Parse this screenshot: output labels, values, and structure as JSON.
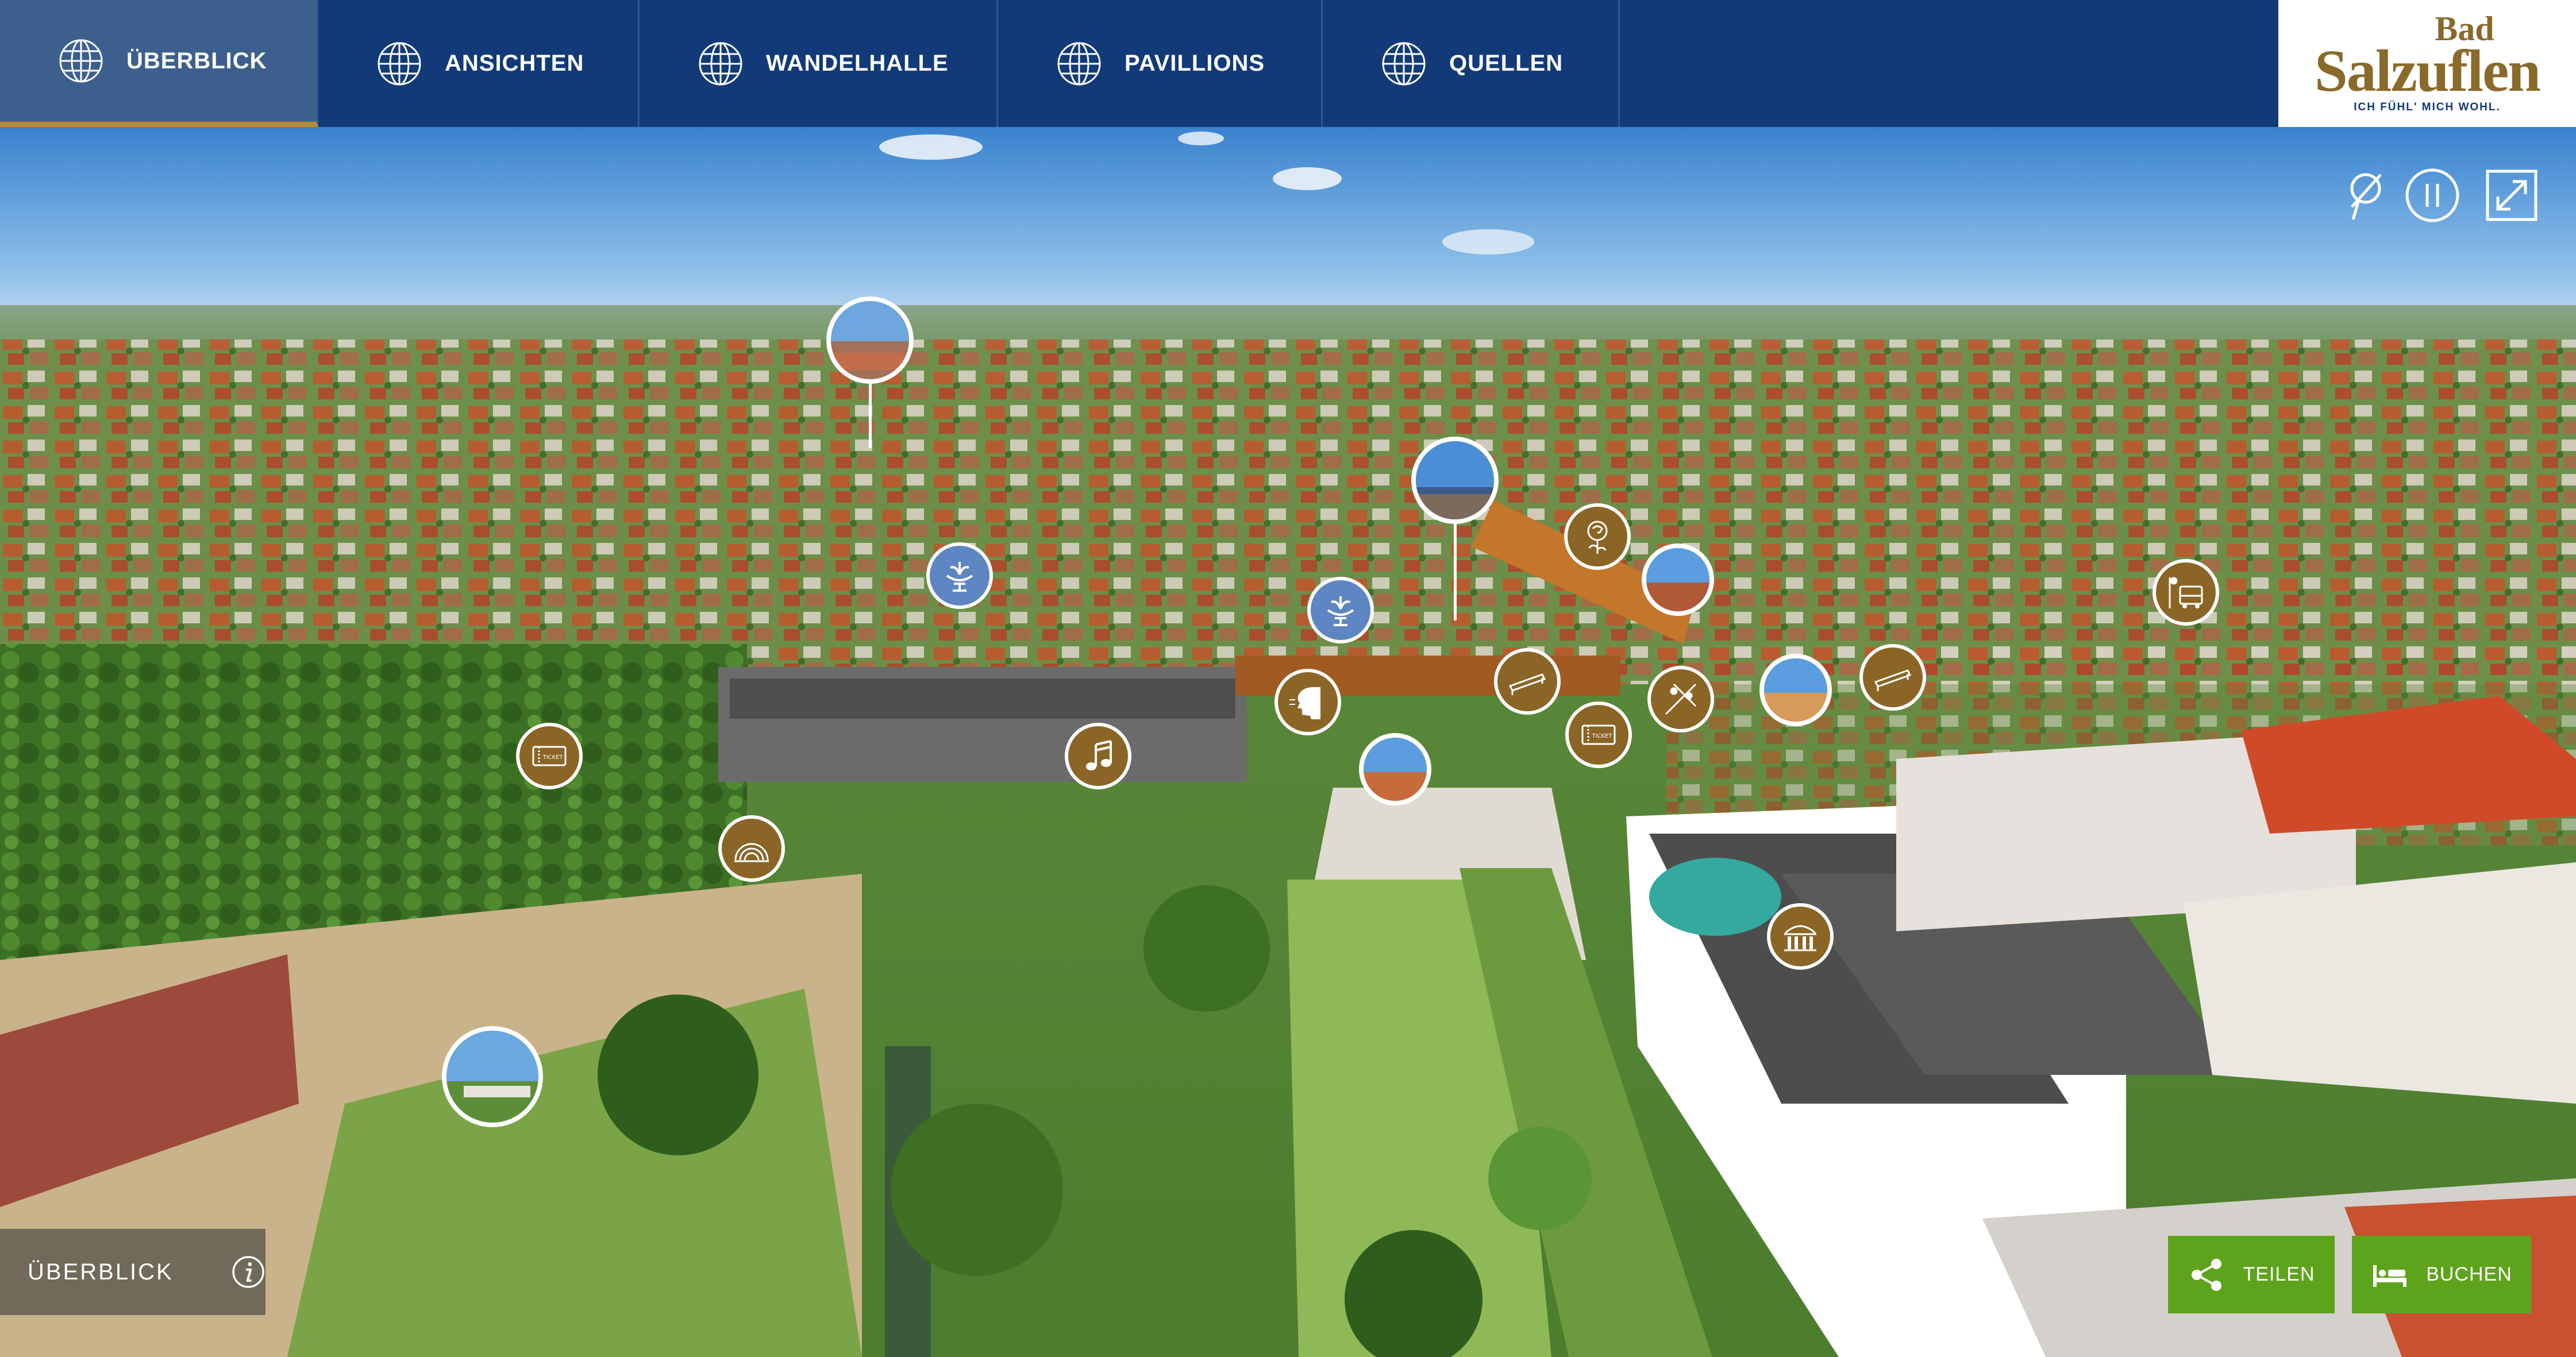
{
  "nav": {
    "tabs": [
      {
        "label": "ÜBERBLICK",
        "active": true
      },
      {
        "label": "ANSICHTEN",
        "active": false
      },
      {
        "label": "WANDELHALLE",
        "active": false
      },
      {
        "label": "PAVILLIONS",
        "active": false
      },
      {
        "label": "QUELLEN",
        "active": false
      }
    ],
    "colors": {
      "bar": "#123a78",
      "active_tab": "#3d5f8e",
      "active_underline": "#b88a33"
    }
  },
  "logo": {
    "line1": "Bad",
    "line2": "Salzuflen",
    "tagline": "ICH FÜHL' MICH WOHL."
  },
  "viewer_controls": [
    {
      "icon": "location-pin-off-icon"
    },
    {
      "icon": "pause-icon"
    },
    {
      "icon": "fullscreen-icon"
    }
  ],
  "hotspots": [
    {
      "type": "photo",
      "icon": "panorama-thumbnail"
    },
    {
      "type": "photo",
      "icon": "panorama-thumbnail"
    },
    {
      "type": "photo",
      "icon": "panorama-thumbnail"
    },
    {
      "type": "photo",
      "icon": "panorama-thumbnail"
    },
    {
      "type": "photo",
      "icon": "panorama-thumbnail"
    },
    {
      "type": "photo",
      "icon": "panorama-thumbnail"
    },
    {
      "type": "spring",
      "icon": "fountain-icon"
    },
    {
      "type": "spring",
      "icon": "fountain-icon"
    },
    {
      "type": "poi",
      "icon": "ticket-icon"
    },
    {
      "type": "poi",
      "icon": "ticket-icon"
    },
    {
      "type": "poi",
      "icon": "music-icon"
    },
    {
      "type": "poi",
      "icon": "bandshell-icon"
    },
    {
      "type": "poi",
      "icon": "inhalation-icon"
    },
    {
      "type": "poi",
      "icon": "gradierwerk-icon"
    },
    {
      "type": "poi",
      "icon": "rose-icon"
    },
    {
      "type": "poi",
      "icon": "playground-icon"
    },
    {
      "type": "poi",
      "icon": "gradierwerk-icon"
    },
    {
      "type": "poi",
      "icon": "bus-icon"
    },
    {
      "type": "poi",
      "icon": "building-icon"
    }
  ],
  "overview": {
    "label": "ÜBERBLICK",
    "icon": "info-icon"
  },
  "buttons": {
    "share": "TEILEN",
    "book": "BUCHEN"
  },
  "colors": {
    "button_green": "#5ea31c",
    "hotspot_gold": "#8a6526",
    "hotspot_blue": "#5d86c2"
  }
}
